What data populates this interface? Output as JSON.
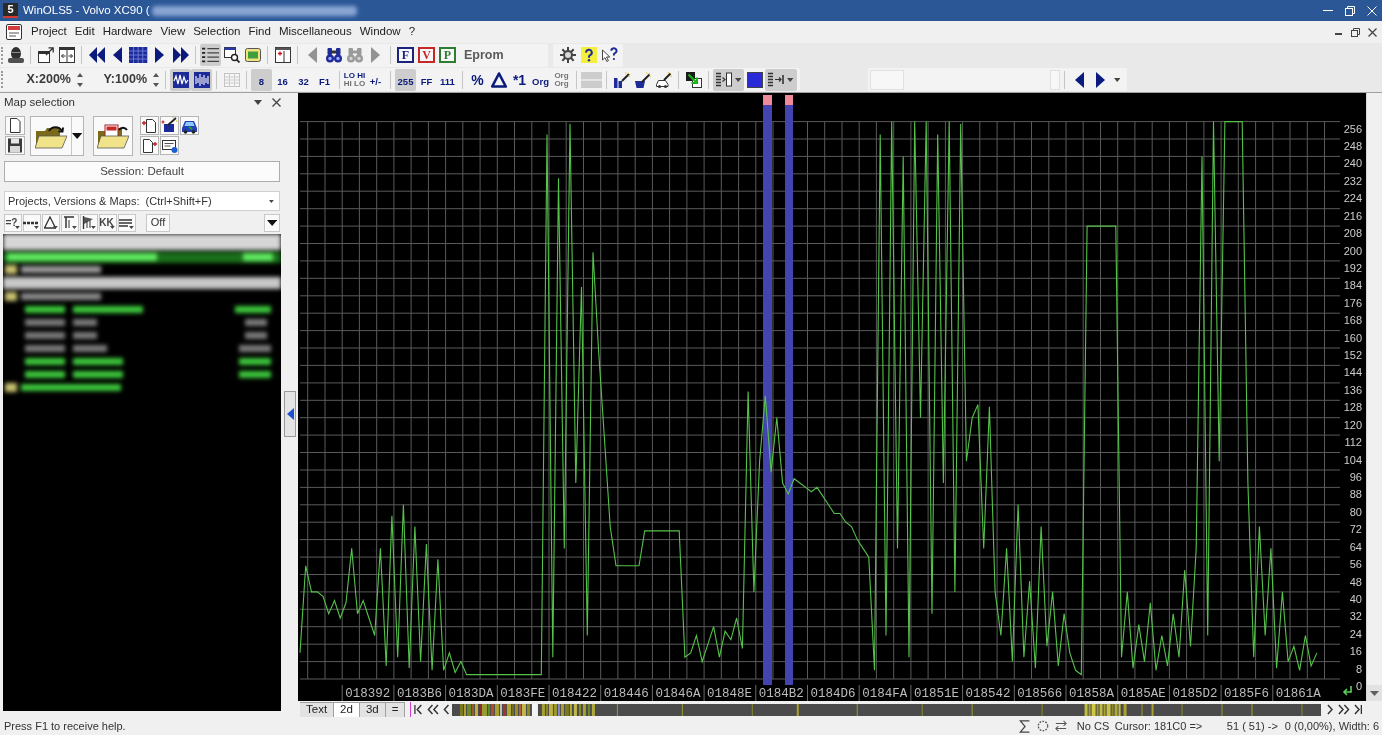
{
  "window": {
    "logo": "5",
    "title": "WinOLS5 - Volvo XC90 ("
  },
  "menu": [
    "Project",
    "Edit",
    "Hardware",
    "View",
    "Selection",
    "Find",
    "Miscellaneous",
    "Window",
    "?"
  ],
  "toolbar_rows": [
    [
      {
        "groups": [
          [
            {
              "kind": "icon",
              "pressed": false,
              "disabled": false
            }
          ],
          [
            {
              "kind": "icon",
              "pressed": false,
              "disabled": false
            },
            {
              "kind": "icon",
              "pressed": false,
              "disabled": false
            }
          ],
          [
            {
              "kind": "icon",
              "pressed": false,
              "disabled": false
            },
            {
              "kind": "icon",
              "pressed": false,
              "disabled": false
            },
            {
              "kind": "icon",
              "pressed": false,
              "disabled": false
            },
            {
              "kind": "icon",
              "pressed": false,
              "disabled": false
            },
            {
              "kind": "icon",
              "pressed": false,
              "disabled": false
            }
          ],
          [
            {
              "kind": "icon",
              "pressed": true,
              "disabled": false
            },
            {
              "kind": "icon",
              "pressed": false,
              "disabled": false
            },
            {
              "kind": "icon",
              "pressed": false,
              "disabled": false
            }
          ],
          [
            {
              "kind": "icon",
              "pressed": false,
              "disabled": false
            }
          ],
          [
            {
              "kind": "icon",
              "pressed": false,
              "disabled": true
            },
            {
              "kind": "icon",
              "pressed": false,
              "disabled": false
            },
            {
              "kind": "icon",
              "pressed": false,
              "disabled": true
            },
            {
              "kind": "icon",
              "pressed": false,
              "disabled": true
            }
          ],
          [
            {
              "kind": "letter",
              "label": "F",
              "color": "#1a237e",
              "pressed": false,
              "disabled": false
            },
            {
              "kind": "letter",
              "label": "V",
              "color": "#c62828",
              "pressed": false,
              "disabled": false
            },
            {
              "kind": "letter",
              "label": "P",
              "color": "#2e7d32",
              "pressed": false,
              "disabled": false
            },
            {
              "kind": "text",
              "label": "Eprom",
              "pressed": false,
              "disabled": false
            }
          ]
        ]
      },
      {
        "groups": [
          [
            {
              "kind": "icon",
              "pressed": false,
              "disabled": false
            },
            {
              "kind": "icon",
              "pressed": false,
              "disabled": false
            },
            {
              "kind": "icon",
              "pressed": false,
              "disabled": false
            }
          ]
        ]
      }
    ],
    [
      {
        "groups": [
          [
            {
              "kind": "spin",
              "label": "X:200%",
              "pressed": false,
              "disabled": false
            },
            {
              "kind": "spin",
              "label": "Y:100%",
              "pressed": false,
              "disabled": false
            }
          ],
          [
            {
              "kind": "icon",
              "pressed": true,
              "disabled": false
            },
            {
              "kind": "icon",
              "pressed": true,
              "disabled": false
            }
          ],
          [
            {
              "kind": "icon",
              "pressed": false,
              "disabled": true
            }
          ],
          [
            {
              "kind": "label",
              "label": "8",
              "pressed": true,
              "disabled": false
            },
            {
              "kind": "label",
              "label": "16",
              "pressed": false,
              "disabled": false
            },
            {
              "kind": "label",
              "label": "32",
              "pressed": false,
              "disabled": false
            },
            {
              "kind": "label",
              "label": "F1",
              "pressed": false,
              "disabled": false
            }
          ],
          [
            {
              "kind": "label2",
              "lines": [
                "LO HI",
                "HI LO"
              ],
              "pressed": false,
              "disabled": false
            },
            {
              "kind": "label",
              "label": "+/-",
              "pressed": false,
              "disabled": false
            }
          ],
          [
            {
              "kind": "label",
              "label": "255",
              "pressed": true,
              "disabled": false
            },
            {
              "kind": "label",
              "label": "FF",
              "pressed": false,
              "disabled": false
            },
            {
              "kind": "label",
              "label": "111",
              "pressed": false,
              "disabled": false
            }
          ],
          [
            {
              "kind": "symbol",
              "label": "%",
              "pressed": false,
              "disabled": false
            },
            {
              "kind": "icon",
              "pressed": false,
              "disabled": false
            },
            {
              "kind": "symbol",
              "label": "*1",
              "pressed": false,
              "disabled": false
            },
            {
              "kind": "label",
              "label": "Org",
              "pressed": false,
              "disabled": false
            },
            {
              "kind": "label2",
              "lines": [
                "Org",
                "Org"
              ],
              "pressed": false,
              "disabled": true
            }
          ],
          [
            {
              "kind": "icon",
              "pressed": false,
              "disabled": true
            }
          ],
          [
            {
              "kind": "icon",
              "pressed": false,
              "disabled": false
            },
            {
              "kind": "icon",
              "pressed": false,
              "disabled": false
            },
            {
              "kind": "icon",
              "pressed": false,
              "disabled": false
            }
          ],
          [
            {
              "kind": "icon",
              "pressed": false,
              "disabled": false
            }
          ],
          [
            {
              "kind": "dropdown",
              "pressed": true,
              "disabled": false
            },
            {
              "kind": "icon",
              "pressed": false,
              "disabled": false
            },
            {
              "kind": "dropdown",
              "pressed": true,
              "disabled": false
            }
          ]
        ]
      },
      {
        "groups": [
          [
            {
              "kind": "range",
              "pressed": false,
              "disabled": true
            }
          ],
          [
            {
              "kind": "icon",
              "pressed": false,
              "disabled": false
            },
            {
              "kind": "icon",
              "pressed": false,
              "disabled": false
            },
            {
              "kind": "overflow",
              "pressed": false,
              "disabled": false
            }
          ]
        ]
      }
    ]
  ],
  "map_selection": {
    "title": "Map selection",
    "session_button": "Session: Default",
    "search": {
      "placeholder": "Projects, Versions & Maps:  (Ctrl+Shift+F)"
    },
    "filter_tools": [
      {
        "kind": "label",
        "label": "=?"
      },
      {
        "kind": "icon"
      },
      {
        "kind": "icon"
      },
      {
        "kind": "icon"
      },
      {
        "kind": "icon"
      },
      {
        "kind": "label",
        "label": "KK"
      },
      {
        "kind": "icon"
      },
      {
        "kind": "button",
        "label": "Off"
      }
    ]
  },
  "hex_view": {
    "value_scale": [
      "256",
      "248",
      "240",
      "232",
      "224",
      "216",
      "208",
      "200",
      "192",
      "184",
      "176",
      "168",
      "160",
      "152",
      "144",
      "136",
      "128",
      "120",
      "112",
      "104",
      "96",
      "88",
      "80",
      "72",
      "64",
      "56",
      "48",
      "40",
      "32",
      "24",
      "16",
      "8",
      "0"
    ],
    "addresses": [
      "018392",
      "0183B6",
      "0183DA",
      "0183FE",
      "018422",
      "018446",
      "01846A",
      "01848E",
      "0184B2",
      "0184D6",
      "0184FA",
      "01851E",
      "018542",
      "018566",
      "01858A",
      "0185AE",
      "0185D2",
      "0185F6",
      "01861A"
    ],
    "tabs": [
      {
        "label": "Text",
        "selected": false
      },
      {
        "label": "2d",
        "selected": true
      },
      {
        "label": "3d",
        "selected": false
      },
      {
        "label": "=",
        "selected": false
      }
    ]
  },
  "status_bar": {
    "help": "Press F1 to receive help.",
    "checksum": "No CS",
    "cursor": "Cursor: 181C0 =>",
    "value": "51 ( 51) ->",
    "info": "0 (0,00%), Width: 6"
  }
}
